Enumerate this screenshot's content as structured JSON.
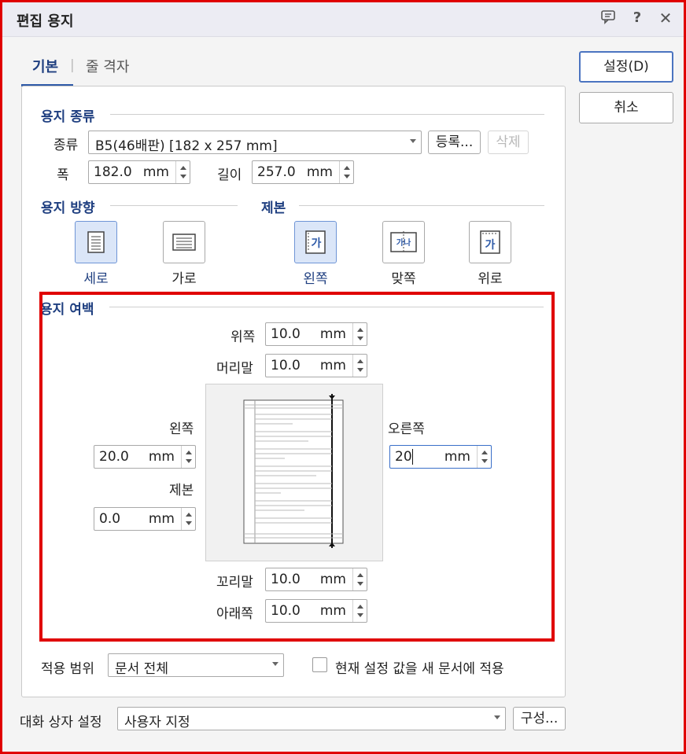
{
  "window": {
    "title": "편집 용지"
  },
  "titlebar_icons": [
    "comment-icon",
    "help-icon",
    "close-icon"
  ],
  "tabs": [
    {
      "label": "기본",
      "active": true
    },
    {
      "label": "줄 격자",
      "active": false
    }
  ],
  "buttons": {
    "ok": "설정(D)",
    "cancel": "취소"
  },
  "paper_type": {
    "title": "용지 종류",
    "type_label": "종류",
    "type_value": "B5(46배판)  [182 x 257 mm]",
    "register": "등록...",
    "delete": "삭제",
    "width_label": "폭",
    "width": {
      "value": "182.0",
      "unit": "mm"
    },
    "length_label": "길이",
    "length": {
      "value": "257.0",
      "unit": "mm"
    }
  },
  "orientation": {
    "title": "용지 방향",
    "options": [
      {
        "label": "세로",
        "selected": true
      },
      {
        "label": "가로",
        "selected": false
      }
    ]
  },
  "binding": {
    "title": "제본",
    "options": [
      {
        "label": "왼쪽",
        "selected": true
      },
      {
        "label": "맞쪽",
        "selected": false
      },
      {
        "label": "위로",
        "selected": false
      }
    ],
    "glyph": "가",
    "glyph_split": "가나"
  },
  "margins": {
    "title": "용지 여백",
    "top_label": "위쪽",
    "top": {
      "value": "10.0",
      "unit": "mm"
    },
    "header_label": "머리말",
    "header": {
      "value": "10.0",
      "unit": "mm"
    },
    "left_label": "왼쪽",
    "left": {
      "value": "20.0",
      "unit": "mm"
    },
    "binding_label": "제본",
    "binding": {
      "value": "0.0",
      "unit": "mm"
    },
    "right_label": "오른쪽",
    "right": {
      "value": "20",
      "unit": "mm"
    },
    "footer_label": "꼬리말",
    "footer": {
      "value": "10.0",
      "unit": "mm"
    },
    "bottom_label": "아래쪽",
    "bottom": {
      "value": "10.0",
      "unit": "mm"
    }
  },
  "apply": {
    "label": "적용 범위",
    "value": "문서 전체",
    "checkbox_label": "현재 설정 값을 새 문서에 적용",
    "checkbox_checked": false
  },
  "dialog_settings": {
    "label": "대화 상자 설정",
    "value": "사용자 지정",
    "configure": "구성..."
  },
  "colors": {
    "accent": "#1f3f80",
    "highlight": "#e00000",
    "selected_bg": "#dbe6f8"
  }
}
